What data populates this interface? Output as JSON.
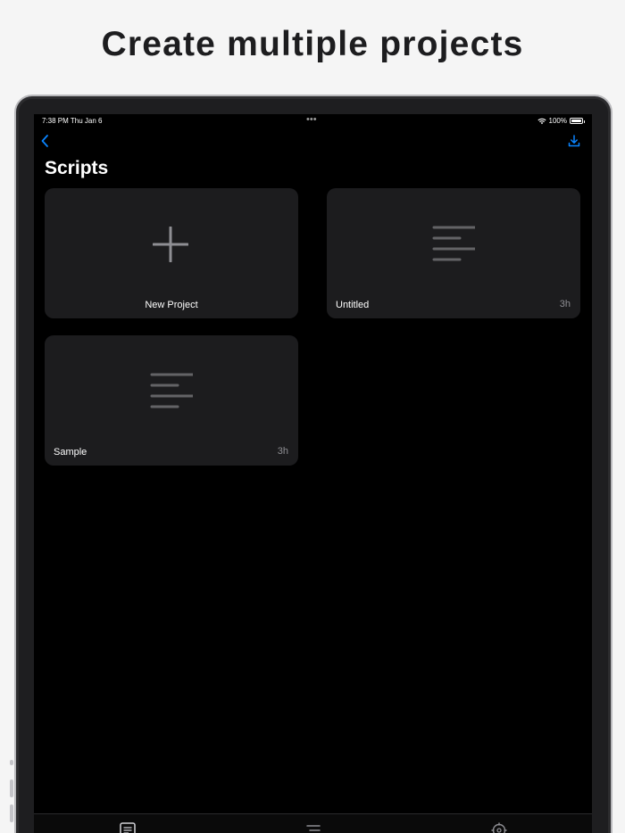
{
  "headline": "Create multiple projects",
  "status_bar": {
    "time": "7:38 PM  Thu Jan 6",
    "battery_text": "100%",
    "battery_level": 1.0
  },
  "nav": {
    "title": "Scripts",
    "back_icon": "chevron-left-icon",
    "download_icon": "download-icon"
  },
  "projects": [
    {
      "label": "New Project",
      "time": "",
      "icon": "plus-icon"
    },
    {
      "label": "Untitled",
      "time": "3h",
      "icon": "document-lines-icon"
    },
    {
      "label": "Sample",
      "time": "3h",
      "icon": "document-lines-icon"
    }
  ],
  "tabs": [
    {
      "icon": "scripts-tab-icon"
    },
    {
      "icon": "outline-tab-icon"
    },
    {
      "icon": "settings-tab-icon"
    }
  ],
  "colors": {
    "accent": "#0a84ff",
    "card_bg": "#1c1c1e",
    "secondary_text": "#8e8e93"
  }
}
